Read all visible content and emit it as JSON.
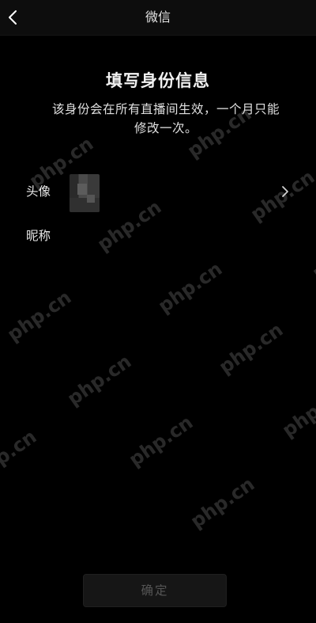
{
  "nav": {
    "back_icon": "chevron-left-icon",
    "title": "微信"
  },
  "form": {
    "heading": "填写身份信息",
    "description": "该身份会在所有直播间生效，一个月只能修改一次。",
    "avatar_label": "头像",
    "nickname_label": "昵称",
    "chevron_icon": "chevron-right-icon"
  },
  "actions": {
    "confirm_label": "确定"
  },
  "watermark": {
    "text": "php.cn"
  }
}
